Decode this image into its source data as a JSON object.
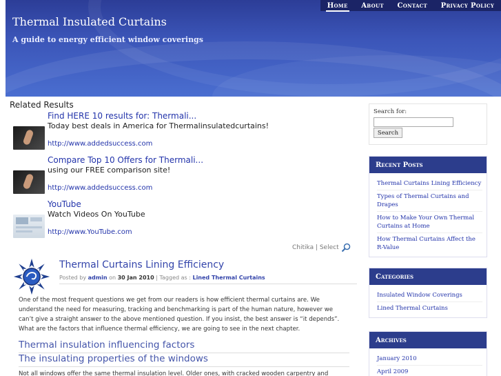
{
  "header": {
    "title": "Thermal Insulated Curtains",
    "tagline": "A guide to energy efficient window coverings"
  },
  "nav": {
    "items": [
      {
        "label": "Home",
        "active": true
      },
      {
        "label": "About",
        "active": false
      },
      {
        "label": "Contact",
        "active": false
      },
      {
        "label": "Privacy Policy",
        "active": false
      }
    ]
  },
  "related": {
    "title": "Related Results",
    "ads": [
      {
        "title": "Find HERE 10 results for: Thermali...",
        "desc": "Today best deals in America for Thermalinsulatedcurtains!",
        "url": "http://www.addedsuccess.com",
        "icon": "finger-touch-icon"
      },
      {
        "title": "Compare Top 10 Offers for Thermali...",
        "desc": "using our FREE comparison site!",
        "url": "http://www.addedsuccess.com",
        "icon": "finger-touch-icon"
      },
      {
        "title": "YouTube",
        "desc": "Watch Videos On YouTube",
        "url": "http://www.YouTube.com",
        "icon": "youtube-thumbnail-icon"
      }
    ],
    "chitika": "Chitika | Select"
  },
  "post": {
    "title": "Thermal Curtains Lining Efficiency",
    "meta_posted_by": "Posted by",
    "author": "admin",
    "meta_on": "on",
    "date": "30 Jan 2010",
    "meta_tagged": "| Tagged as :",
    "tag": "Lined Thermal Curtains",
    "paragraph1": "One of the most frequent questions we get from our readers is how efficient thermal curtains are. We understand the need for measuring, tracking and benchmarking is part of the human nature, however we can’t give a straight answer to the above mentioned question. If you insist, the best answer is “it depends”. What are the factors that influence thermal efficiency, we are going to see in the next chapter.",
    "heading1": "Thermal insulation influencing factors",
    "heading2": "The insulating properties of the windows",
    "paragraph2": "Not all windows offer the same thermal insulation level. Older ones, with cracked wooden carpentry and"
  },
  "sidebar": {
    "search_label": "Search for:",
    "search_value": "",
    "search_button": "Search",
    "recent_posts_title": "Recent Posts",
    "recent_posts": [
      "Thermal Curtains Lining Efficiency",
      "Types of Thermal Curtains and Drapes",
      "How to Make Your Own Thermal Curtains at Home",
      "How Thermal Curtains Affect the R-Value"
    ],
    "categories_title": "Categories",
    "categories": [
      "Insulated Window Coverings",
      "Lined Thermal Curtains"
    ],
    "archives_title": "Archives",
    "archives": [
      "January 2010",
      "April 2009"
    ]
  },
  "colors": {
    "header_dark": "#1b2466",
    "header_mid": "#3b55b8",
    "widget_title_bg": "#2c3d8c",
    "link": "#2233aa"
  }
}
